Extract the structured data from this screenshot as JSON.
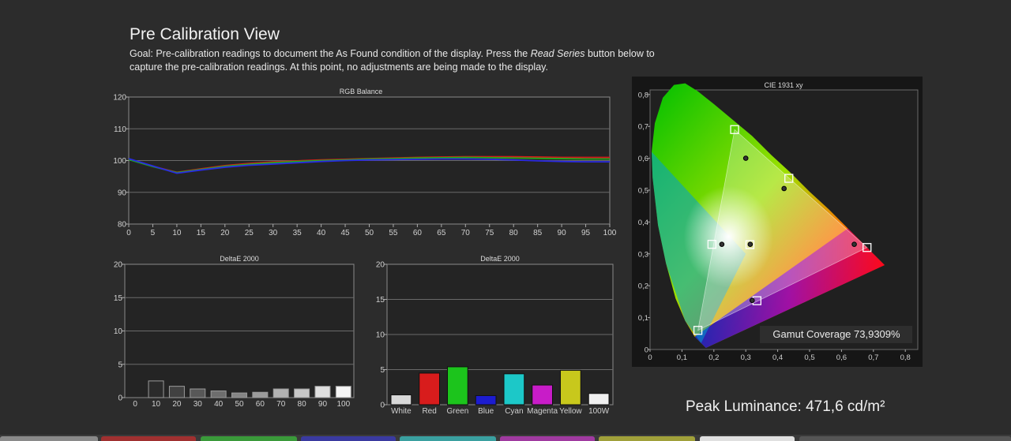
{
  "page": {
    "title": "Pre Calibration View",
    "goal_pre": "Goal: Pre-calibration readings to document the As Found condition of the display. Press the ",
    "goal_emph": "Read Series",
    "goal_post": " button below to capture the pre-calibration readings. At this point, no adjustments are being made to the display.",
    "peak_luminance": "Peak Luminance: 471,6 cd/m²"
  },
  "rgb_balance": {
    "title": "RGB Balance",
    "x_ticks": [
      "0",
      "5",
      "10",
      "15",
      "20",
      "25",
      "30",
      "35",
      "40",
      "45",
      "50",
      "55",
      "60",
      "65",
      "70",
      "75",
      "80",
      "85",
      "90",
      "95",
      "100"
    ],
    "y_ticks": [
      "80",
      "90",
      "100",
      "110",
      "120"
    ],
    "ylim": [
      80,
      120
    ],
    "xlim": [
      0,
      100
    ],
    "colors": {
      "red": "#d21b1b",
      "green": "#1faa1f",
      "blue": "#2a2ae0"
    }
  },
  "deltae_grayscale": {
    "title": "DeltaE 2000",
    "categories": [
      "0",
      "10",
      "20",
      "30",
      "40",
      "50",
      "60",
      "70",
      "80",
      "90",
      "100"
    ],
    "y_ticks": [
      "0",
      "5",
      "10",
      "15",
      "20"
    ],
    "ylim": [
      0,
      20
    ]
  },
  "deltae_color": {
    "title": "DeltaE 2000",
    "categories": [
      "White",
      "Red",
      "Green",
      "Blue",
      "Cyan",
      "Magenta",
      "Yellow",
      "100W"
    ],
    "y_ticks": [
      "0",
      "5",
      "10",
      "15",
      "20"
    ],
    "ylim": [
      0,
      20
    ],
    "bar_colors": [
      "#d8d8d8",
      "#d81c1c",
      "#1cc41c",
      "#1c1cd0",
      "#1cc8c8",
      "#c81cc8",
      "#c8c81c",
      "#f0f0f0"
    ]
  },
  "cie": {
    "title": "CIE 1931 xy",
    "x_ticks": [
      "0",
      "0,1",
      "0,2",
      "0,3",
      "0,4",
      "0,5",
      "0,6",
      "0,7",
      "0,8"
    ],
    "y_ticks": [
      "0",
      "0,1",
      "0,2",
      "0,3",
      "0,4",
      "0,5",
      "0,6",
      "0,7",
      "0,8"
    ],
    "gamut_label": "Gamut Coverage 73,9309%"
  },
  "chart_data": [
    {
      "type": "line",
      "title": "RGB Balance",
      "x": [
        0,
        5,
        10,
        15,
        20,
        25,
        30,
        35,
        40,
        45,
        50,
        55,
        60,
        65,
        70,
        75,
        80,
        85,
        90,
        95,
        100
      ],
      "ylim": [
        80,
        120
      ],
      "xlim": [
        0,
        100
      ],
      "series": [
        {
          "color": "#d21b1b",
          "values": [
            100.5,
            98.2,
            96.3,
            97.4,
            98.4,
            99.1,
            99.6,
            99.9,
            100.2,
            100.4,
            100.6,
            100.8,
            101.0,
            101.1,
            101.2,
            101.2,
            101.2,
            101.1,
            101.0,
            101.0,
            101.0
          ]
        },
        {
          "color": "#1faa1f",
          "values": [
            100.3,
            98.1,
            96.2,
            97.2,
            98.2,
            98.8,
            99.3,
            99.7,
            100.0,
            100.2,
            100.5,
            100.6,
            100.8,
            100.9,
            101.0,
            100.9,
            100.8,
            100.7,
            100.6,
            100.5,
            100.5
          ]
        },
        {
          "color": "#2a2ae0",
          "values": [
            100.6,
            98.3,
            96.0,
            97.0,
            97.9,
            98.5,
            98.9,
            99.3,
            99.7,
            100.0,
            100.2,
            100.3,
            100.4,
            100.5,
            100.5,
            100.4,
            100.2,
            99.9,
            99.7,
            99.6,
            99.6
          ]
        }
      ]
    },
    {
      "type": "bar",
      "title": "DeltaE 2000",
      "categories": [
        "0",
        "10",
        "20",
        "30",
        "40",
        "50",
        "60",
        "70",
        "80",
        "90",
        "100"
      ],
      "values": [
        0,
        2.5,
        1.7,
        1.3,
        1.0,
        0.7,
        0.8,
        1.3,
        1.3,
        1.7,
        1.7
      ],
      "ylim": [
        0,
        20
      ]
    },
    {
      "type": "bar",
      "title": "DeltaE 2000",
      "categories": [
        "White",
        "Red",
        "Green",
        "Blue",
        "Cyan",
        "Magenta",
        "Yellow",
        "100W"
      ],
      "values": [
        1.4,
        4.5,
        5.4,
        1.3,
        4.4,
        2.8,
        4.9,
        1.6
      ],
      "ylim": [
        0,
        20
      ]
    },
    {
      "type": "scatter",
      "title": "CIE 1931 xy",
      "xlim": [
        0,
        0.8
      ],
      "ylim": [
        0,
        0.8
      ],
      "targets": [
        [
          0.265,
          0.69
        ],
        [
          0.15,
          0.06
        ],
        [
          0.68,
          0.32
        ],
        [
          0.313,
          0.329
        ],
        [
          0.194,
          0.33
        ],
        [
          0.335,
          0.153
        ],
        [
          0.435,
          0.537
        ]
      ],
      "measured": [
        [
          0.3,
          0.6
        ],
        [
          0.64,
          0.33
        ],
        [
          0.225,
          0.33
        ],
        [
          0.32,
          0.154
        ],
        [
          0.42,
          0.505
        ],
        [
          0.314,
          0.33
        ]
      ],
      "gamut_coverage": "73,9309%"
    }
  ]
}
